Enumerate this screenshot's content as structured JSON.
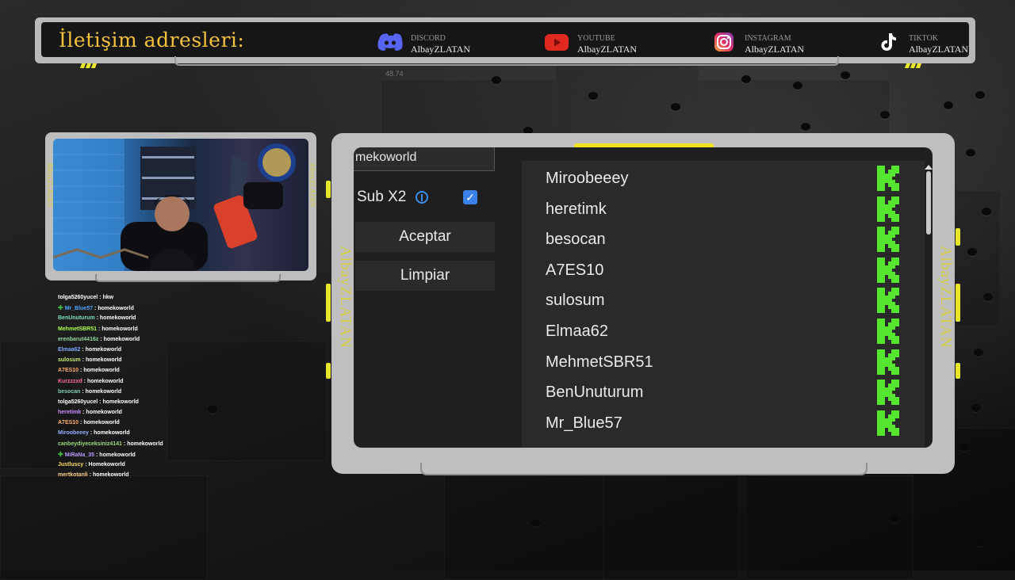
{
  "banner": {
    "title": "İletişim adresleri:",
    "socials": [
      {
        "platform": "DISCORD",
        "handle": "AlbayZLATAN",
        "icon": "discord-icon",
        "color": "#5865f2"
      },
      {
        "platform": "YOUTUBE",
        "handle": "AlbayZLATAN",
        "icon": "youtube-icon",
        "color": "#e0291f"
      },
      {
        "platform": "INSTAGRAM",
        "handle": "AlbayZLATAN",
        "icon": "instagram-icon",
        "color": "#e1306c"
      },
      {
        "platform": "TIKTOK",
        "handle": "AlbayZLATAN",
        "icon": "tiktok-icon",
        "color": "#ffffff"
      }
    ],
    "number": "48.74"
  },
  "camera": {
    "side_label": "AlbayZLATAN"
  },
  "chat": [
    {
      "user": "tolga5260yucel",
      "msg": "hkw",
      "color": "#ffffff",
      "mod": false
    },
    {
      "user": "Mr_Blue57",
      "msg": "homekoworld",
      "color": "#4aa3ff",
      "mod": true
    },
    {
      "user": "BenUnuturum",
      "msg": "homekoworld",
      "color": "#7be0c2",
      "mod": false
    },
    {
      "user": "MehmetSBR51",
      "msg": "homekoworld",
      "color": "#a8ff4a",
      "mod": false
    },
    {
      "user": "erenbarut4416z",
      "msg": "homekoworld",
      "color": "#8fd7a0",
      "mod": false
    },
    {
      "user": "Elmaa62",
      "msg": "homekoworld",
      "color": "#7aa8ff",
      "mod": false
    },
    {
      "user": "sulosum",
      "msg": "homekoworld",
      "color": "#c6e86a",
      "mod": false
    },
    {
      "user": "A7ES10",
      "msg": "homekoworld",
      "color": "#ffb066",
      "mod": false
    },
    {
      "user": "Kurzzzxd",
      "msg": "homekoworld",
      "color": "#ff6b9a",
      "mod": false
    },
    {
      "user": "besocan",
      "msg": "homekoworld",
      "color": "#7ecfae",
      "mod": false
    },
    {
      "user": "tolga5260yucel",
      "msg": "homekoworld",
      "color": "#ffffff",
      "mod": false
    },
    {
      "user": "heretimk",
      "msg": "homekoworld",
      "color": "#c88cff",
      "mod": false
    },
    {
      "user": "A7ES10",
      "msg": "homekoworld",
      "color": "#ffb066",
      "mod": false
    },
    {
      "user": "Miroobeeey",
      "msg": "homekoworld",
      "color": "#8fb0ff",
      "mod": false
    },
    {
      "user": "canbeydiyeceksiniz4141",
      "msg": "homekoworld",
      "color": "#9bd97a",
      "mod": false
    },
    {
      "user": "MiRaNa_35",
      "msg": "homekoworld",
      "color": "#b79bff",
      "mod": true
    },
    {
      "user": "Justluscy",
      "msg": "Homekoworld",
      "color": "#ffd86a",
      "mod": false
    },
    {
      "user": "mertkotanli",
      "msg": "homekoworld",
      "color": "#ffcf8a",
      "mod": false
    }
  ],
  "panel": {
    "search_value": "mekoworld",
    "sub_label": "Sub X2",
    "sub_checked": true,
    "accept_label": "Aceptar",
    "clear_label": "Limpiar",
    "side_label": "AlbayZLATAN",
    "k_color": "#56e62f",
    "entries": [
      "Miroobeeey",
      "heretimk",
      "besocan",
      "A7ES10",
      "sulosum",
      "Elmaa62",
      "MehmetSBR51",
      "BenUnuturum",
      "Mr_Blue57"
    ]
  }
}
